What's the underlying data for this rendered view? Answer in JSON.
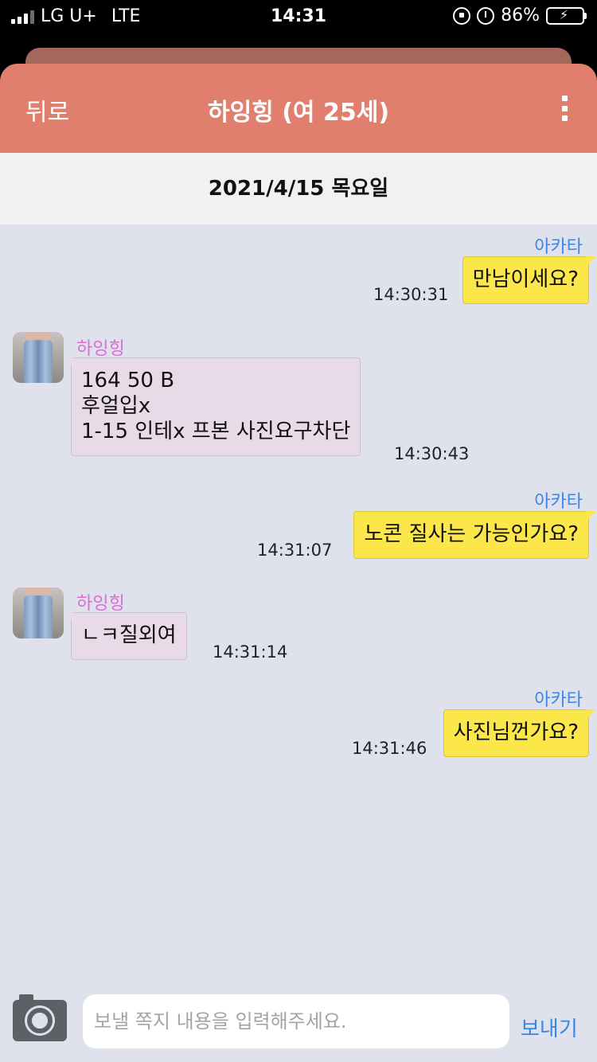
{
  "status_bar": {
    "carrier": "LG U+",
    "network": "LTE",
    "time": "14:31",
    "battery": "86%"
  },
  "header": {
    "back_label": "뒤로",
    "title": "하잉힝 (여 25세)"
  },
  "date_label": "2021/4/15 목요일",
  "messages": [
    {
      "sender": "아카타",
      "lines": [
        "만남이세요?"
      ],
      "time": "14:30:31"
    },
    {
      "sender": "하잉힝",
      "lines": [
        "164  50   B",
        "후얼입x",
        "1-15  인테x 프본 사진요구차단"
      ],
      "time": "14:30:43"
    },
    {
      "sender": "아카타",
      "lines": [
        "노콘 질사는 가능인가요?"
      ],
      "time": "14:31:07"
    },
    {
      "sender": "하잉힝",
      "lines": [
        "ㄴㅋ질외여"
      ],
      "time": "14:31:14"
    },
    {
      "sender": "아카타",
      "lines": [
        "사진님껀가요?"
      ],
      "time": "14:31:46"
    }
  ],
  "input": {
    "placeholder": "보낼 쪽지 내용을 입력해주세요.",
    "value": ""
  },
  "send_label": "보내기",
  "colors": {
    "header": "#e07f6d",
    "my_bubble": "#fbe74a",
    "their_bubble": "#e8dbe7",
    "my_name": "#3a86e8",
    "their_name": "#e06ad0",
    "chat_background": "#dfe2ec"
  }
}
